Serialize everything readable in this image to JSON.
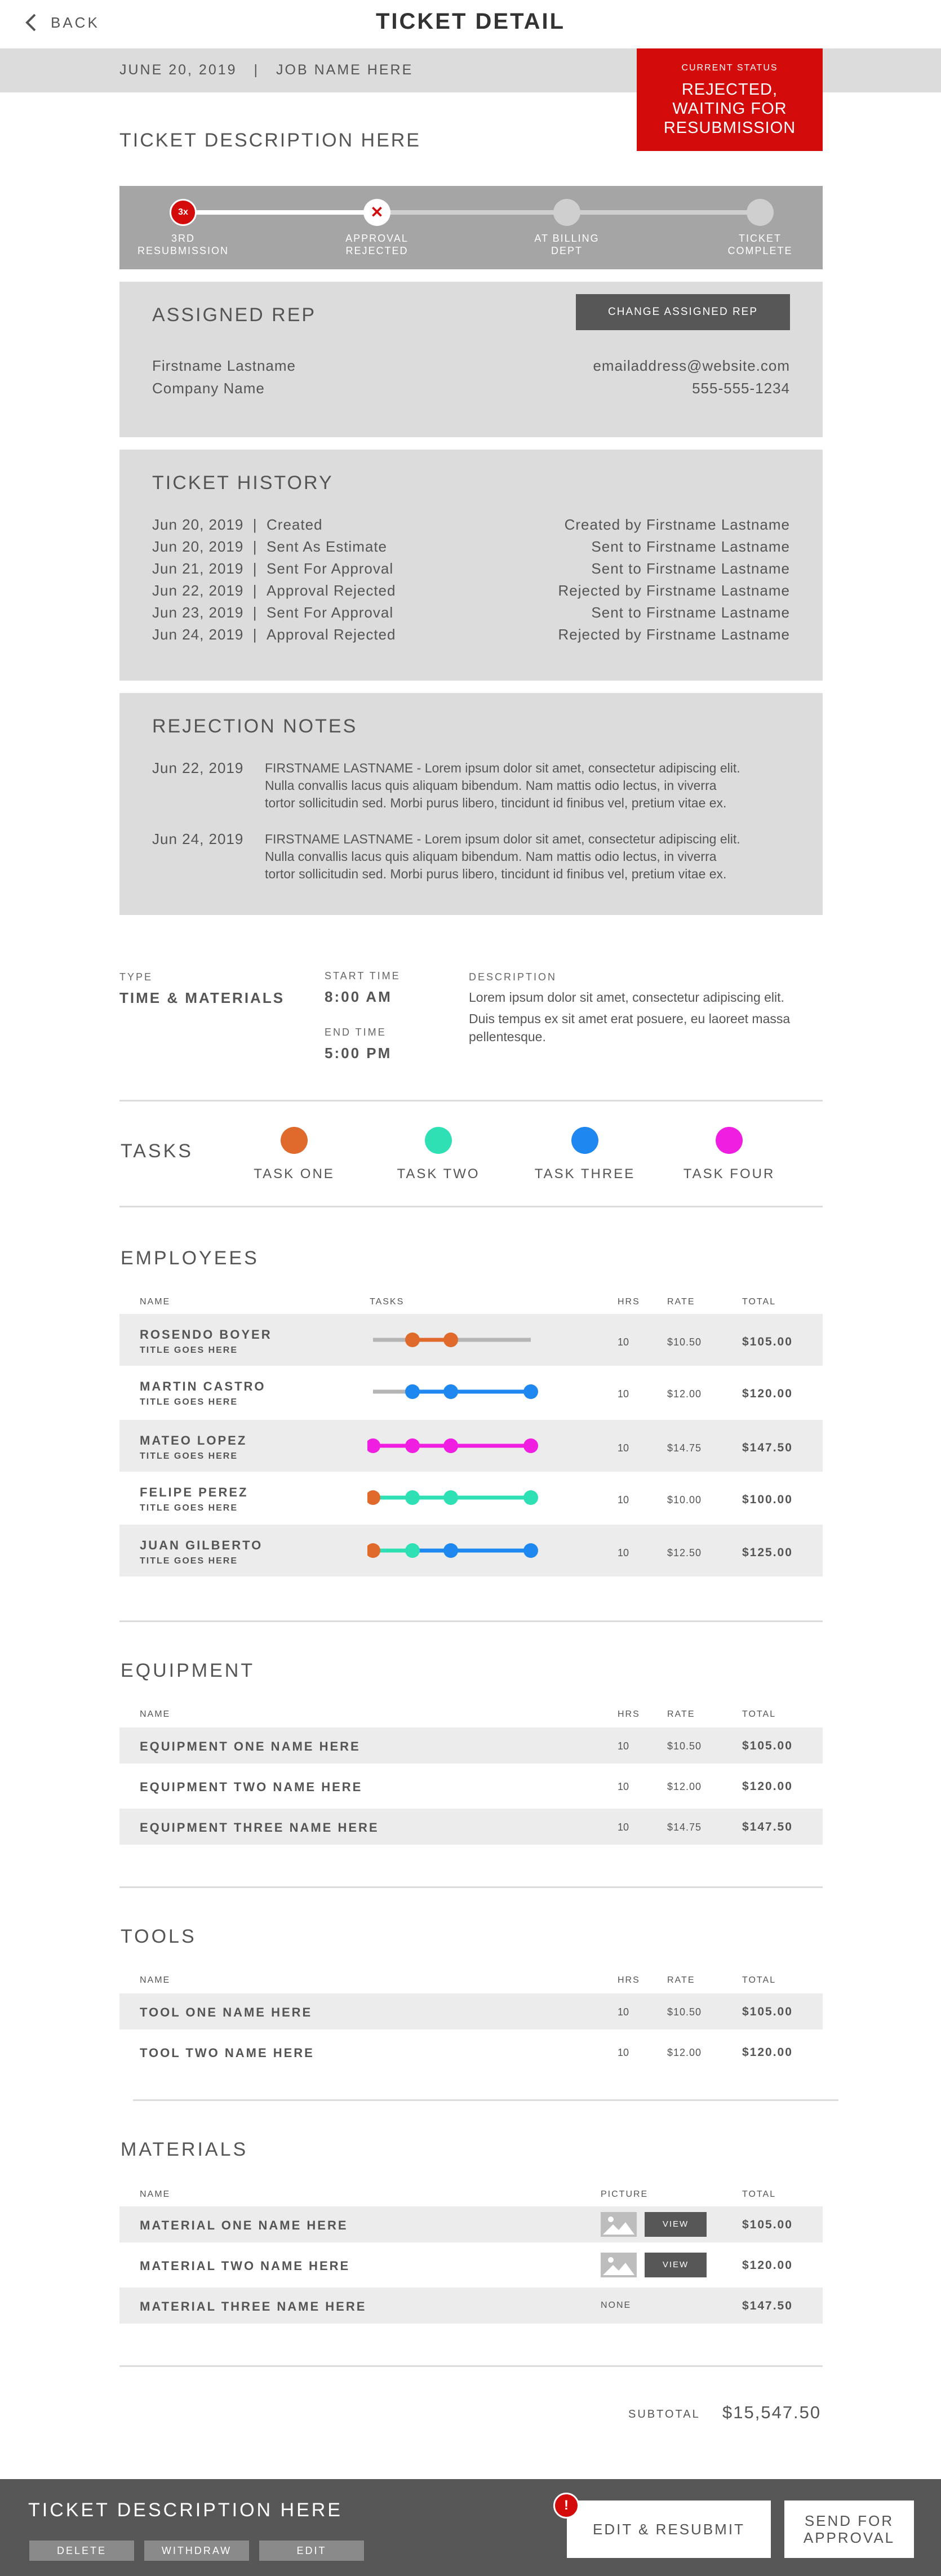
{
  "header": {
    "back_label": "BACK",
    "title": "TICKET DETAIL",
    "date": "JUNE 20, 2019",
    "separator": "|",
    "job_name": "JOB NAME HERE"
  },
  "status": {
    "label": "CURRENT STATUS",
    "value_line1": "REJECTED,",
    "value_line2": "WAITING FOR",
    "value_line3": "RESUBMISSION",
    "color": "#d40b0b"
  },
  "ticket_description": "TICKET DESCRIPTION HERE",
  "progress": {
    "steps": [
      {
        "line1": "3RD",
        "line2": "RESUBMISSION",
        "badge": "3x",
        "state": "current-red"
      },
      {
        "line1": "APPROVAL",
        "line2": "REJECTED",
        "badge": "✕",
        "state": "rejected"
      },
      {
        "line1": "AT BILLING",
        "line2": "DEPT",
        "state": "pending"
      },
      {
        "line1": "TICKET",
        "line2": "COMPLETE",
        "state": "pending"
      }
    ]
  },
  "assigned_rep": {
    "title": "ASSIGNED REP",
    "change_button": "CHANGE ASSIGNED REP",
    "name": "Firstname Lastname",
    "company": "Company Name",
    "email": "emailaddress@website.com",
    "phone": "555-555-1234"
  },
  "ticket_history": {
    "title": "TICKET HISTORY",
    "rows": [
      {
        "date": "Jun 20, 2019",
        "event": "Created",
        "by": "Created by Firstname Lastname"
      },
      {
        "date": "Jun 20, 2019",
        "event": "Sent As Estimate",
        "by": "Sent to Firstname Lastname"
      },
      {
        "date": "Jun 21, 2019",
        "event": "Sent For Approval",
        "by": "Sent to Firstname Lastname"
      },
      {
        "date": "Jun 22, 2019",
        "event": "Approval Rejected",
        "by": "Rejected by Firstname Lastname"
      },
      {
        "date": "Jun 23, 2019",
        "event": "Sent For Approval",
        "by": "Sent to Firstname Lastname"
      },
      {
        "date": "Jun 24, 2019",
        "event": "Approval Rejected",
        "by": "Rejected by Firstname Lastname"
      }
    ]
  },
  "rejection_notes": {
    "title": "REJECTION NOTES",
    "notes": [
      {
        "date": "Jun 22, 2019",
        "line1": "FIRSTNAME LASTNAME - Lorem ipsum dolor sit amet, consectetur adipiscing elit.",
        "line2": "Nulla convallis lacus quis aliquam bibendum. Nam mattis odio lectus, in viverra",
        "line3": "tortor sollicitudin sed. Morbi purus libero, tincidunt id finibus vel, pretium vitae ex."
      },
      {
        "date": "Jun 24, 2019",
        "line1": "FIRSTNAME LASTNAME - Lorem ipsum dolor sit amet, consectetur adipiscing elit.",
        "line2": "Nulla convallis lacus quis aliquam bibendum. Nam mattis odio lectus, in viverra",
        "line3": "tortor sollicitudin sed. Morbi purus libero, tincidunt id finibus vel, pretium vitae ex."
      }
    ]
  },
  "info": {
    "type_label": "TYPE",
    "type_value": "TIME & MATERIALS",
    "start_label": "START TIME",
    "start_value": "8:00 AM",
    "end_label": "END TIME",
    "end_value": "5:00 PM",
    "desc_label": "DESCRIPTION",
    "desc_line1": "Lorem ipsum dolor sit amet, consectetur adipiscing elit.",
    "desc_line2": "Duis tempus ex sit amet erat posuere, eu laoreet massa",
    "desc_line3": "pellentesque."
  },
  "tasks": {
    "title": "TASKS",
    "items": [
      {
        "label": "TASK ONE",
        "color": "#e06a2b"
      },
      {
        "label": "TASK TWO",
        "color": "#2fe0b5"
      },
      {
        "label": "TASK THREE",
        "color": "#1e87f0"
      },
      {
        "label": "TASK FOUR",
        "color": "#f01ee0"
      }
    ]
  },
  "employees": {
    "title": "EMPLOYEES",
    "headers": {
      "name": "NAME",
      "tasks": "TASKS",
      "hrs": "HRS",
      "rate": "RATE",
      "total": "TOTAL"
    },
    "rows": [
      {
        "name": "ROSENDO BOYER",
        "title": "TITLE GOES HERE",
        "hrs": "10",
        "rate": "$10.50",
        "total": "$105.00",
        "tasks": [
          "gray",
          "TASK ONE",
          "TASK ONE",
          "gray"
        ]
      },
      {
        "name": "MARTIN CASTRO",
        "title": "TITLE GOES HERE",
        "hrs": "10",
        "rate": "$12.00",
        "total": "$120.00",
        "tasks": [
          "gray",
          "TASK THREE",
          "TASK THREE",
          "TASK THREE"
        ]
      },
      {
        "name": "MATEO LOPEZ",
        "title": "TITLE GOES HERE",
        "hrs": "10",
        "rate": "$14.75",
        "total": "$147.50",
        "tasks": [
          "TASK FOUR",
          "TASK FOUR",
          "TASK FOUR",
          "TASK FOUR"
        ]
      },
      {
        "name": "FELIPE PEREZ",
        "title": "TITLE GOES HERE",
        "hrs": "10",
        "rate": "$10.00",
        "total": "$100.00",
        "tasks": [
          "TASK ONE",
          "TASK TWO",
          "TASK TWO",
          "TASK TWO"
        ]
      },
      {
        "name": "JUAN GILBERTO",
        "title": "TITLE GOES HERE",
        "hrs": "10",
        "rate": "$12.50",
        "total": "$125.00",
        "tasks": [
          "TASK ONE",
          "TASK TWO",
          "TASK THREE",
          "TASK THREE"
        ]
      }
    ]
  },
  "equipment": {
    "title": "EQUIPMENT",
    "headers": {
      "name": "NAME",
      "hrs": "HRS",
      "rate": "RATE",
      "total": "TOTAL"
    },
    "rows": [
      {
        "name": "EQUIPMENT ONE NAME HERE",
        "hrs": "10",
        "rate": "$10.50",
        "total": "$105.00"
      },
      {
        "name": "EQUIPMENT TWO NAME HERE",
        "hrs": "10",
        "rate": "$12.00",
        "total": "$120.00"
      },
      {
        "name": "EQUIPMENT THREE NAME HERE",
        "hrs": "10",
        "rate": "$14.75",
        "total": "$147.50"
      }
    ]
  },
  "tools": {
    "title": "TOOLS",
    "headers": {
      "name": "NAME",
      "hrs": "HRS",
      "rate": "RATE",
      "total": "TOTAL"
    },
    "rows": [
      {
        "name": "TOOL ONE NAME HERE",
        "hrs": "10",
        "rate": "$10.50",
        "total": "$105.00"
      },
      {
        "name": "TOOL TWO NAME HERE",
        "hrs": "10",
        "rate": "$12.00",
        "total": "$120.00"
      }
    ]
  },
  "materials": {
    "title": "MATERIALS",
    "headers": {
      "name": "NAME",
      "picture": "PICTURE",
      "total": "TOTAL"
    },
    "view_label": "VIEW",
    "rows": [
      {
        "name": "MATERIAL ONE NAME HERE",
        "picture": "image",
        "total": "$105.00"
      },
      {
        "name": "MATERIAL TWO NAME HERE",
        "picture": "image",
        "total": "$120.00"
      },
      {
        "name": "MATERIAL THREE NAME HERE",
        "picture": "NONE",
        "total": "$147.50"
      }
    ]
  },
  "subtotal": {
    "label": "SUBTOTAL",
    "value": "$15,547.50"
  },
  "footer": {
    "title": "TICKET DESCRIPTION HERE",
    "delete": "DELETE",
    "withdraw": "WITHDRAW",
    "edit": "EDIT",
    "edit_resubmit": "EDIT & RESUBMIT",
    "send_line1": "SEND FOR",
    "send_line2": "APPROVAL",
    "alert": "!"
  }
}
